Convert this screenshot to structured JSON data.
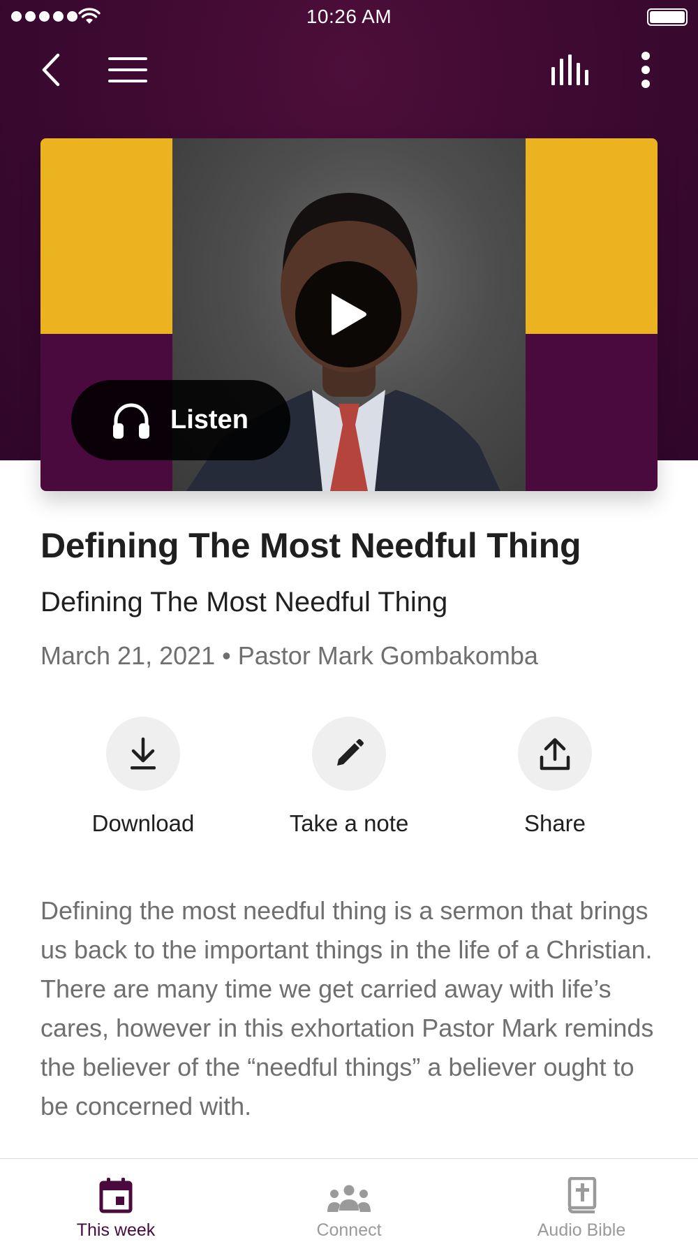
{
  "status_bar": {
    "time": "10:26 AM"
  },
  "nav": {
    "back_icon": "chevron-left-icon",
    "menu_icon": "hamburger-menu-icon",
    "audio_icon": "audio-bars-icon",
    "more_icon": "more-vertical-icon"
  },
  "media": {
    "panel_colors": {
      "gold": "#ebb320",
      "purple": "#4b0a3e"
    },
    "play_icon": "play-icon",
    "listen_label": "Listen",
    "listen_icon": "headphones-icon"
  },
  "sermon": {
    "title": "Defining The Most Needful Thing",
    "subtitle": "Defining The Most Needful Thing",
    "meta": "March 21, 2021 • Pastor Mark Gombakomba",
    "description": "Defining the most needful thing is a sermon that brings us back to the important things in the life of a Christian. There are many time we get carried away with life’s cares, however in this exhortation Pastor Mark reminds the believer of the “needful things” a believer ought to be concerned with."
  },
  "actions": [
    {
      "label": "Download",
      "icon": "download-icon"
    },
    {
      "label": "Take a note",
      "icon": "pencil-icon"
    },
    {
      "label": "Share",
      "icon": "share-upload-icon"
    }
  ],
  "tabs": [
    {
      "label": "This week",
      "icon": "calendar-icon",
      "active": true
    },
    {
      "label": "Connect",
      "icon": "people-group-icon",
      "active": false
    },
    {
      "label": "Audio Bible",
      "icon": "bible-icon",
      "active": false
    }
  ],
  "colors": {
    "header_bg": "#3e0a32",
    "accent_active_tab": "#4b0a3e"
  }
}
